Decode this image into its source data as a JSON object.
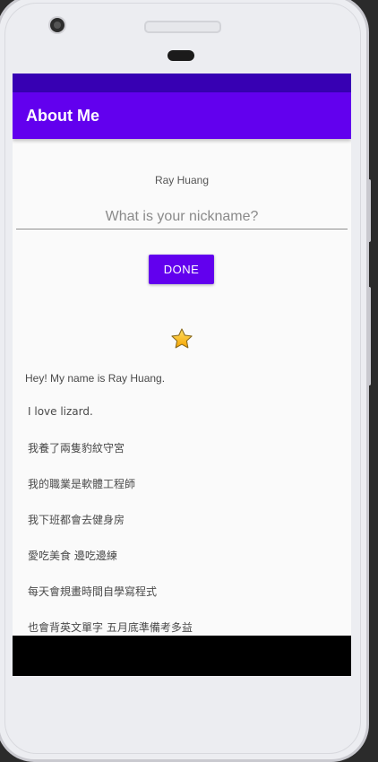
{
  "app": {
    "title": "About Me"
  },
  "profile": {
    "name": "Ray Huang"
  },
  "nickname": {
    "placeholder": "What is your nickname?",
    "value": ""
  },
  "done_button": {
    "label": "DONE"
  },
  "star_icon": "star-icon",
  "bio": {
    "intro": "Hey! My name is Ray Huang.",
    "lines": [
      "I love lizard.",
      "我養了兩隻豹紋守宮",
      "我的職業是軟體工程師",
      "我下班都會去健身房",
      "愛吃美食 邊吃邊練",
      "每天會規畫時間自學寫程式",
      "也會背英文單字 五月底準備考多益"
    ]
  },
  "colors": {
    "status_bar": "#3700b3",
    "app_bar": "#6200ee",
    "button": "#6200ee"
  }
}
